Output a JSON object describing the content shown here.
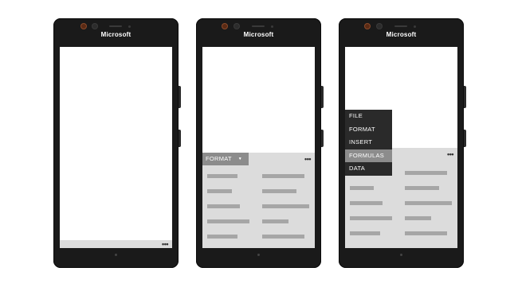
{
  "brand": "Microsoft",
  "more_glyph": "•••",
  "phones": [
    {
      "state": "app-bar-collapsed"
    },
    {
      "state": "ribbon-open",
      "ribbon_button": {
        "label": "FORMAT",
        "caret": "▼"
      }
    },
    {
      "state": "menu-open",
      "menu": {
        "items": [
          "FILE",
          "FORMAT",
          "INSERT",
          "FORMULAS",
          "DATA"
        ],
        "selected": "FORMULAS"
      }
    }
  ],
  "icons": [
    "more-options-icon",
    "caret-down-icon",
    "front-camera-icon",
    "home-indicator-icon"
  ]
}
